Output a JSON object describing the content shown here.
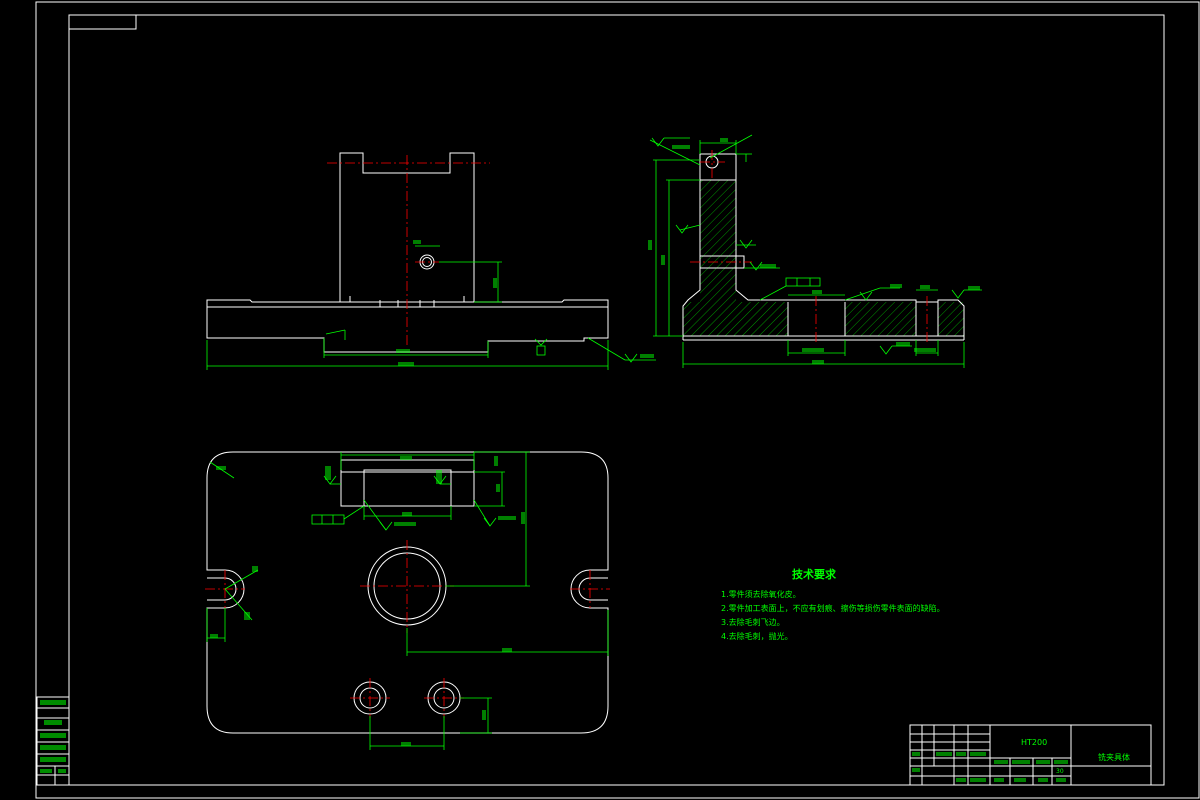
{
  "drawing": {
    "line_color": "#ffffff",
    "dimension_color": "#00ff00",
    "centerline_color": "#ff0000",
    "background": "#000000"
  },
  "technical_requirements": {
    "title": "技术要求",
    "items": [
      "1.零件须去除氧化皮。",
      "2.零件加工表面上，不应有划痕、擦伤等损伤零件表面的缺陷。",
      "3.去除毛刺飞边。",
      "4.去除毛刺，抛光。"
    ]
  },
  "title_block": {
    "material": "HT200",
    "part_name": "铣夹具体",
    "scale_value": "30"
  }
}
